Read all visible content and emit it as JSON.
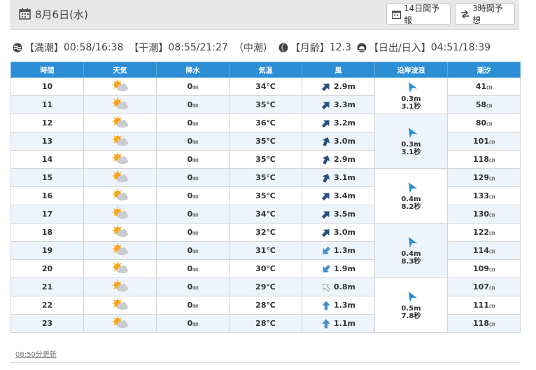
{
  "header": {
    "date": "8月6日(水)",
    "btn_14day": "14日間予報",
    "btn_3hour": "3時間予想"
  },
  "info": {
    "high_tide_label": "【満潮】",
    "high_tide": "00:58/16:38",
    "low_tide_label": "【干潮】",
    "low_tide": "08:55/21:27",
    "tide_type": "（中潮）",
    "moon_label": "【月齢】",
    "moon_age": "12.3",
    "sun_label": "【日出/日入】",
    "sun": "04:51/18:39"
  },
  "table": {
    "headers": [
      "時間",
      "天気",
      "降水",
      "気温",
      "風",
      "沿岸波浪",
      "潮汐"
    ],
    "rows": [
      {
        "hour": "10",
        "weather": "sunny-cloudy",
        "precip": "0",
        "temp": "34℃",
        "wind_dir": "NE",
        "wind": "2.9m",
        "tide": "41"
      },
      {
        "hour": "11",
        "weather": "sunny-cloudy",
        "precip": "0",
        "temp": "35℃",
        "wind_dir": "NE",
        "wind": "3.3m",
        "tide": "58"
      },
      {
        "hour": "12",
        "weather": "sunny-cloudy",
        "precip": "0",
        "temp": "36℃",
        "wind_dir": "NE",
        "wind": "3.2m",
        "tide": "80"
      },
      {
        "hour": "13",
        "weather": "sunny-cloudy",
        "precip": "0",
        "temp": "35℃",
        "wind_dir": "NNE",
        "wind": "3.0m",
        "tide": "101"
      },
      {
        "hour": "14",
        "weather": "sunny-cloudy",
        "precip": "0",
        "temp": "35℃",
        "wind_dir": "NNE",
        "wind": "2.9m",
        "tide": "118"
      },
      {
        "hour": "15",
        "weather": "sunny-cloudy",
        "precip": "0",
        "temp": "35℃",
        "wind_dir": "NNE",
        "wind": "3.1m",
        "tide": "129"
      },
      {
        "hour": "16",
        "weather": "sunny-cloudy",
        "precip": "0",
        "temp": "35℃",
        "wind_dir": "NE",
        "wind": "3.4m",
        "tide": "133"
      },
      {
        "hour": "17",
        "weather": "sunny-cloudy",
        "precip": "0",
        "temp": "34℃",
        "wind_dir": "NE",
        "wind": "3.5m",
        "tide": "130"
      },
      {
        "hour": "18",
        "weather": "sunny-cloudy",
        "precip": "0",
        "temp": "32℃",
        "wind_dir": "NE",
        "wind": "3.0m",
        "tide": "122"
      },
      {
        "hour": "19",
        "weather": "sunny-cloudy",
        "precip": "0",
        "temp": "31℃",
        "wind_dir": "SW",
        "wind": "1.3m",
        "tide": "114"
      },
      {
        "hour": "20",
        "weather": "sunny-cloudy",
        "precip": "0",
        "temp": "30℃",
        "wind_dir": "SW",
        "wind": "1.9m",
        "tide": "109"
      },
      {
        "hour": "21",
        "weather": "sunny-cloudy",
        "precip": "0",
        "temp": "29℃",
        "wind_dir": "NW-light",
        "wind": "0.8m",
        "tide": "107"
      },
      {
        "hour": "22",
        "weather": "sunny-cloudy",
        "precip": "0",
        "temp": "28℃",
        "wind_dir": "N",
        "wind": "1.3m",
        "tide": "111"
      },
      {
        "hour": "23",
        "weather": "sunny-cloudy",
        "precip": "0",
        "temp": "28℃",
        "wind_dir": "N",
        "wind": "1.1m",
        "tide": "118"
      }
    ],
    "precip_unit": "㎜",
    "tide_unit": "㎝",
    "waves": [
      {
        "height": "0.3m",
        "period": "3.1秒"
      },
      {
        "height": "0.3m",
        "period": "3.1秒"
      },
      {
        "height": "0.4m",
        "period": "8.2秒"
      },
      {
        "height": "0.4m",
        "period": "8.3秒"
      },
      {
        "height": "0.5m",
        "period": "7.8秒"
      }
    ]
  },
  "footer": {
    "updated": "08:50分更新"
  }
}
